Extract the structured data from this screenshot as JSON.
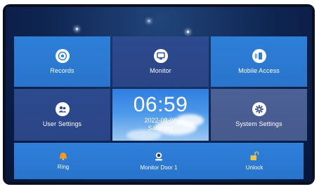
{
  "tiles": {
    "records": {
      "label": "Records",
      "icon": "records-icon"
    },
    "monitor": {
      "label": "Monitor",
      "icon": "monitor-icon"
    },
    "mobile_access": {
      "label": "Mobile Access",
      "icon": "mobile-access-icon"
    },
    "user_settings": {
      "label": "User Settings",
      "icon": "users-icon"
    },
    "system_settings": {
      "label": "System Settings",
      "icon": "gear-icon"
    }
  },
  "clock": {
    "time": "06:59",
    "date": "2022-08-08",
    "day": "Saturday"
  },
  "bottom_bar": {
    "ring": {
      "label": "Ring",
      "icon": "ring-icon"
    },
    "monitor_door": {
      "label": "Monitor Door 1",
      "icon": "camera-icon"
    },
    "unlock": {
      "label": "Unlock",
      "icon": "unlock-icon"
    }
  },
  "colors": {
    "tile_blue": "#2d7fd8",
    "tile_navy": "#2d4a8f",
    "tile_slate": "#4c6196",
    "background": "#0e2450"
  }
}
